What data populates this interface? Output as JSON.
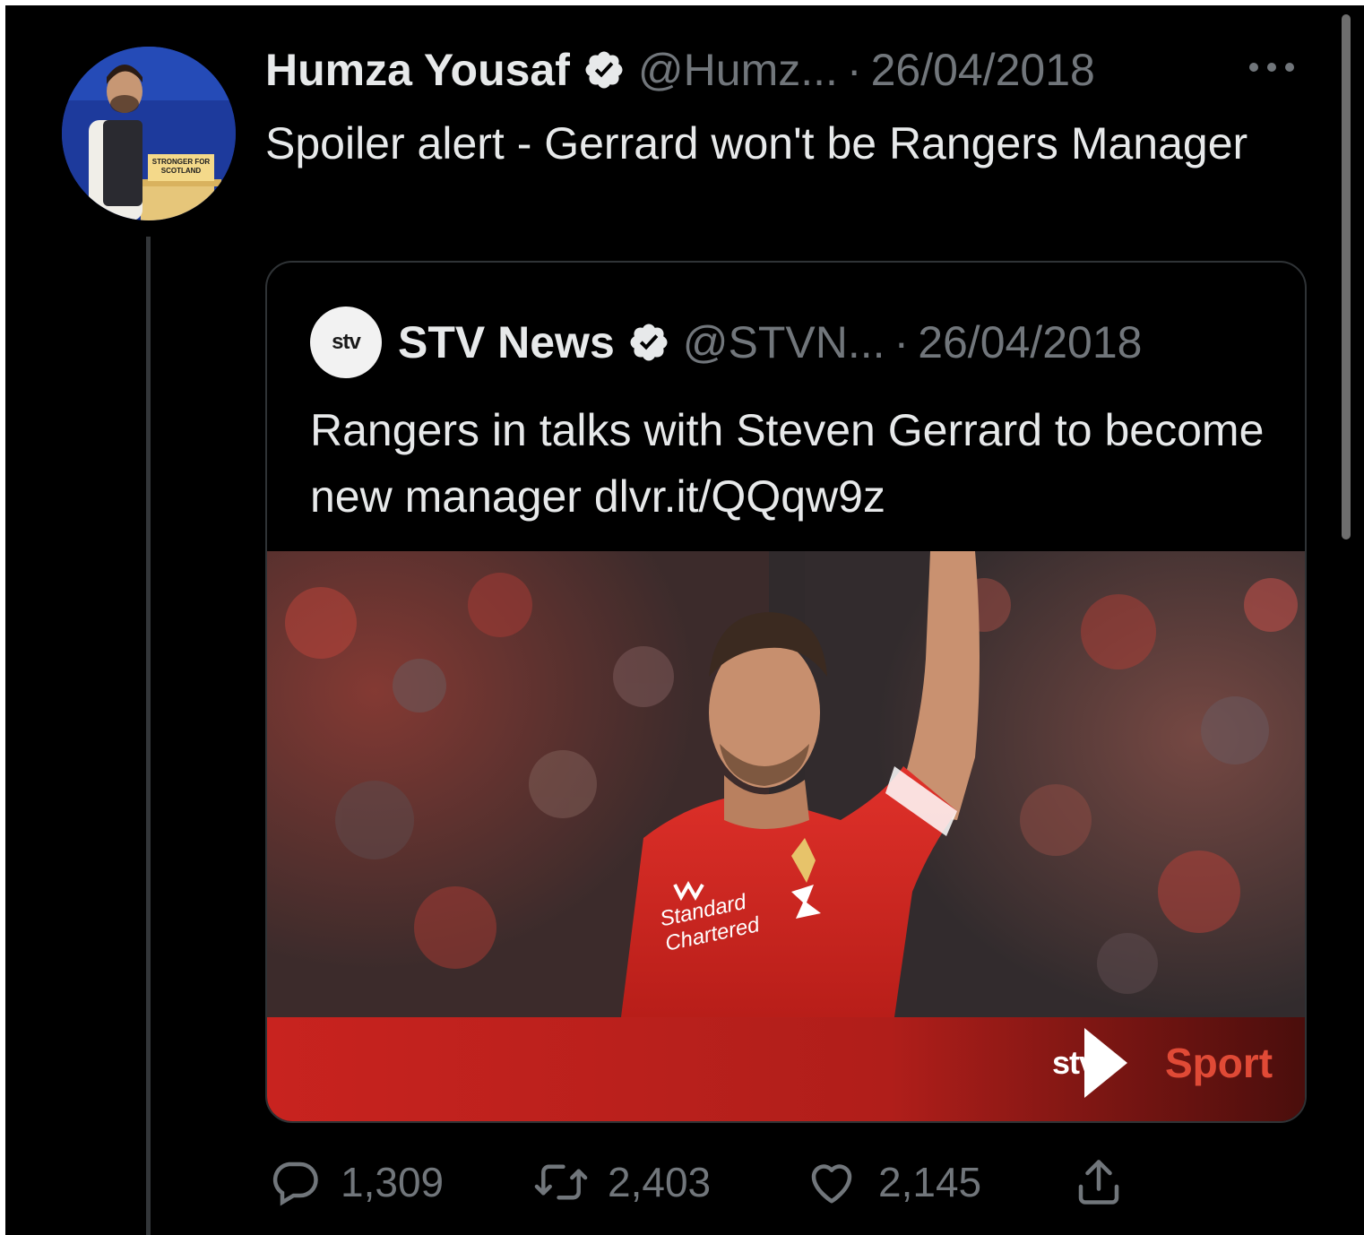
{
  "tweet": {
    "author_name": "Humza Yousaf",
    "handle": "@Humz...",
    "separator": "·",
    "date": "26/04/2018",
    "text": "Spoiler alert - Gerrard won't be Rangers Manager",
    "avatar_sign_text": "STRONGER FOR SCOTLAND"
  },
  "quoted_tweet": {
    "author_name": "STV News",
    "handle": "@STVN...",
    "separator": "·",
    "date": "26/04/2018",
    "text": "Rangers in talks with Steven Gerrard to become new manager dlvr.it/QQqw9z",
    "avatar_logo_text": "stv",
    "media": {
      "shirt_sponsor_text": "Standard Chartered",
      "shirt_brand_text": "W",
      "banner_logo_text": "stv",
      "banner_label": "Sport"
    }
  },
  "actions": {
    "replies": "1,309",
    "retweets": "2,403",
    "likes": "2,145"
  },
  "icons": {
    "verified": "verified-badge-icon",
    "more": "more-options-icon",
    "reply": "reply-icon",
    "retweet": "retweet-icon",
    "like": "heart-icon",
    "share": "share-icon"
  },
  "colors": {
    "background": "#000000",
    "primary_text": "#e7e9ea",
    "secondary_text": "#71767b",
    "border": "#2f3336",
    "banner_red": "#c8231f"
  }
}
